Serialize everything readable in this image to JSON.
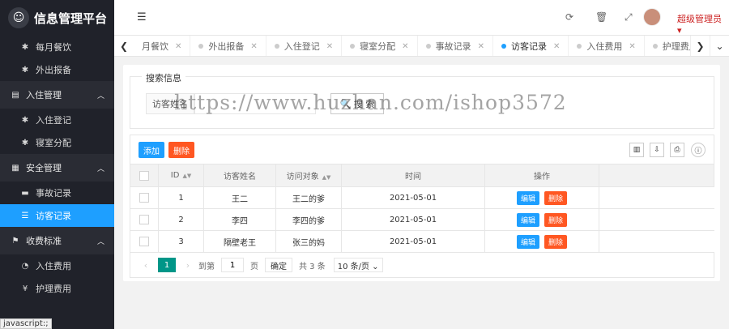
{
  "app": {
    "title": "信息管理平台"
  },
  "sidebar": {
    "items": [
      {
        "type": "item",
        "label": "每月餐饮",
        "icon": "gear-icon",
        "glyph": "✱"
      },
      {
        "type": "item",
        "label": "外出报备",
        "icon": "gear-icon",
        "glyph": "✱"
      },
      {
        "type": "group",
        "label": "入住管理",
        "icon": "document-icon",
        "glyph": "▤"
      },
      {
        "type": "item",
        "label": "入住登记",
        "icon": "gear-icon",
        "glyph": "✱"
      },
      {
        "type": "item",
        "label": "寝室分配",
        "icon": "gear-icon",
        "glyph": "✱"
      },
      {
        "type": "group",
        "label": "安全管理",
        "icon": "calendar-icon",
        "glyph": "▦"
      },
      {
        "type": "item",
        "label": "事故记录",
        "icon": "monitor-icon",
        "glyph": "▬"
      },
      {
        "type": "item",
        "label": "访客记录",
        "icon": "list-icon",
        "glyph": "☰",
        "active": true
      },
      {
        "type": "group",
        "label": "收费标准",
        "icon": "flag-icon",
        "glyph": "⚑"
      },
      {
        "type": "item",
        "label": "入住费用",
        "icon": "clock-icon",
        "glyph": "◔"
      },
      {
        "type": "item",
        "label": "护理费用",
        "icon": "yen-icon",
        "glyph": "¥"
      }
    ]
  },
  "statusbar": {
    "text": "javascript:;"
  },
  "topbar": {
    "user": "超级管理员 ▾"
  },
  "tabs": [
    {
      "label": "月餐饮"
    },
    {
      "label": "外出报备"
    },
    {
      "label": "入住登记"
    },
    {
      "label": "寝室分配"
    },
    {
      "label": "事故记录"
    },
    {
      "label": "访客记录",
      "active": true
    },
    {
      "label": "入住费用"
    },
    {
      "label": "护理费用"
    }
  ],
  "search": {
    "legend": "搜索信息",
    "label": "访客姓名",
    "value": "",
    "button": "🔍 搜 索"
  },
  "toolbar": {
    "add": "添加",
    "delete": "删除"
  },
  "table": {
    "headers": [
      "ID",
      "访客姓名",
      "访问对象",
      "时间",
      "操作"
    ],
    "edit_label": "编辑",
    "delete_label": "删除",
    "rows": [
      {
        "id": "1",
        "name": "王二",
        "target": "王二的爹",
        "time": "2021-05-01"
      },
      {
        "id": "2",
        "name": "李四",
        "target": "李四的爹",
        "time": "2021-05-01"
      },
      {
        "id": "3",
        "name": "隔壁老王",
        "target": "张三的妈",
        "time": "2021-05-01"
      }
    ]
  },
  "pager": {
    "current": "1",
    "goto_label": "到第",
    "page_value": "1",
    "page_unit": "页",
    "confirm": "确定",
    "total": "共 3 条",
    "per_page": "10 条/页 ⌄"
  },
  "watermark": "https://www.huzhan.com/ishop3572",
  "colors": {
    "primary": "#1e9fff",
    "danger": "#ff5722",
    "pager": "#009688",
    "sidebar": "#20222a"
  }
}
